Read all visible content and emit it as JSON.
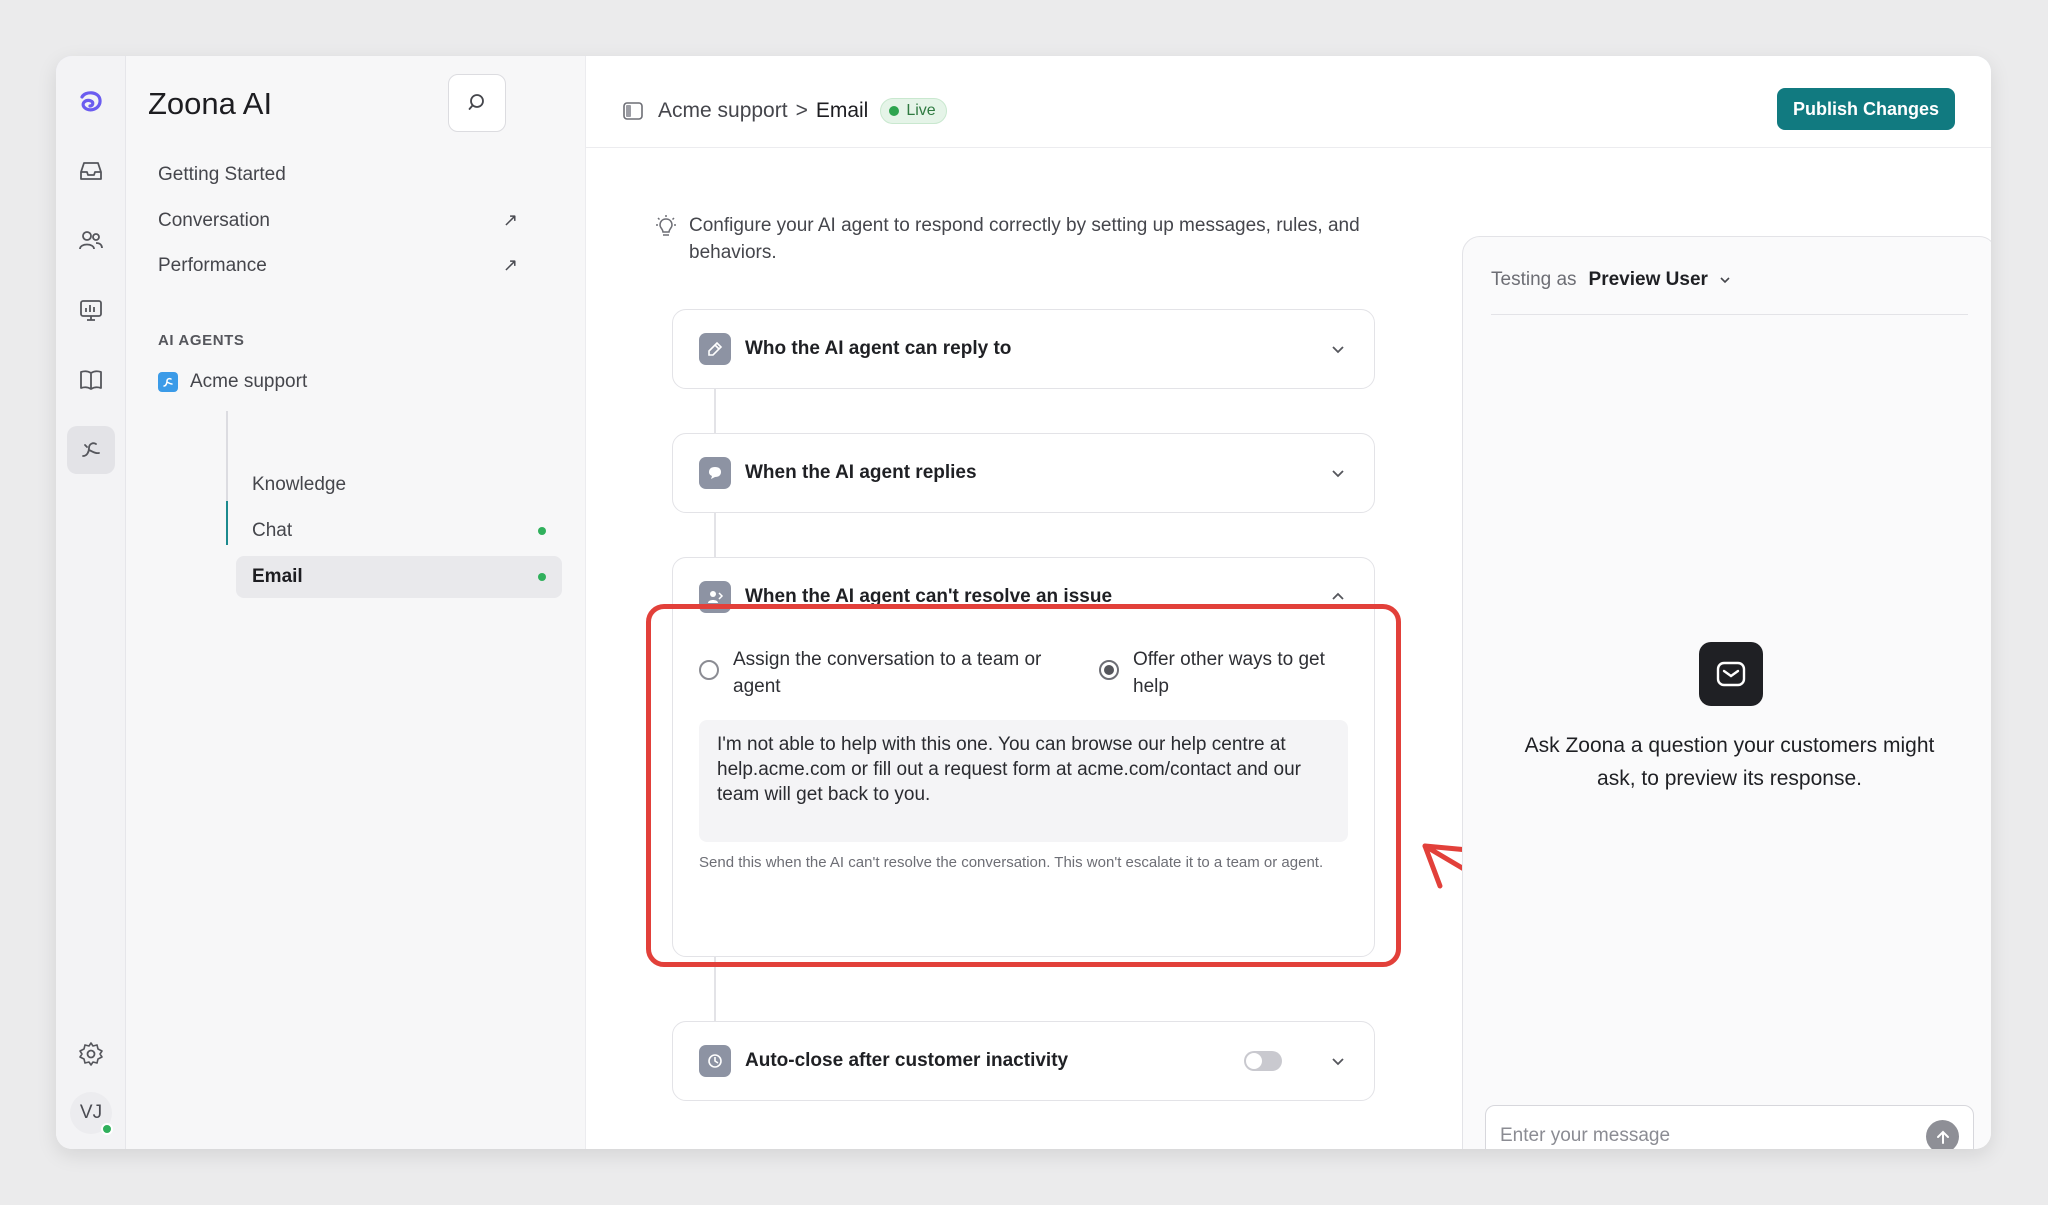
{
  "app": {
    "title": "Zoona AI"
  },
  "rail": {
    "icons": [
      "logo-icon",
      "inbox-icon",
      "people-icon",
      "reports-icon",
      "book-icon",
      "ai-agent-icon",
      "gear-icon"
    ],
    "avatar_initials": "VJ"
  },
  "sidebar": {
    "nav": [
      {
        "label": "Getting Started",
        "external": false
      },
      {
        "label": "Conversation",
        "external": true
      },
      {
        "label": "Performance",
        "external": true
      }
    ],
    "section_label": "AI AGENTS",
    "agent": {
      "label": "Acme support"
    },
    "sub_items": [
      {
        "label": "Knowledge",
        "live": false
      },
      {
        "label": "Chat",
        "live": true
      },
      {
        "label": "Email",
        "live": true,
        "active": true
      }
    ]
  },
  "header": {
    "breadcrumb_root": "Acme support",
    "breadcrumb_sep": ">",
    "breadcrumb_current": "Email",
    "status": "Live",
    "publish_label": "Publish Changes"
  },
  "main": {
    "intro": "Configure your AI agent to respond correctly by setting up messages, rules, and behaviors.",
    "cards": [
      {
        "title": "Who the AI agent can reply to",
        "expanded": false
      },
      {
        "title": "When the AI agent replies",
        "expanded": false
      },
      {
        "title": "When the AI agent can't resolve an issue",
        "expanded": true,
        "options": [
          {
            "label": "Assign the conversation to a team or agent",
            "selected": false
          },
          {
            "label": "Offer other ways to get help",
            "selected": true
          }
        ],
        "message": "I'm not able to help with this one. You can browse our help centre at help.acme.com or fill out a request form at acme.com/contact and our team will get back to you.",
        "hint": "Send this when the AI can't resolve the conversation. This won't escalate it to a team or agent."
      },
      {
        "title": "Auto-close after customer inactivity",
        "expanded": false,
        "toggle_on": false
      }
    ]
  },
  "preview": {
    "testing_label": "Testing as",
    "testing_value": "Preview User",
    "empty_text": "Ask Zoona a question your customers might ask, to preview its response.",
    "input_placeholder": "Enter your message"
  },
  "colors": {
    "accent": "#117a80",
    "live_green": "#2ea44f",
    "annotation_red": "#e2403a"
  }
}
